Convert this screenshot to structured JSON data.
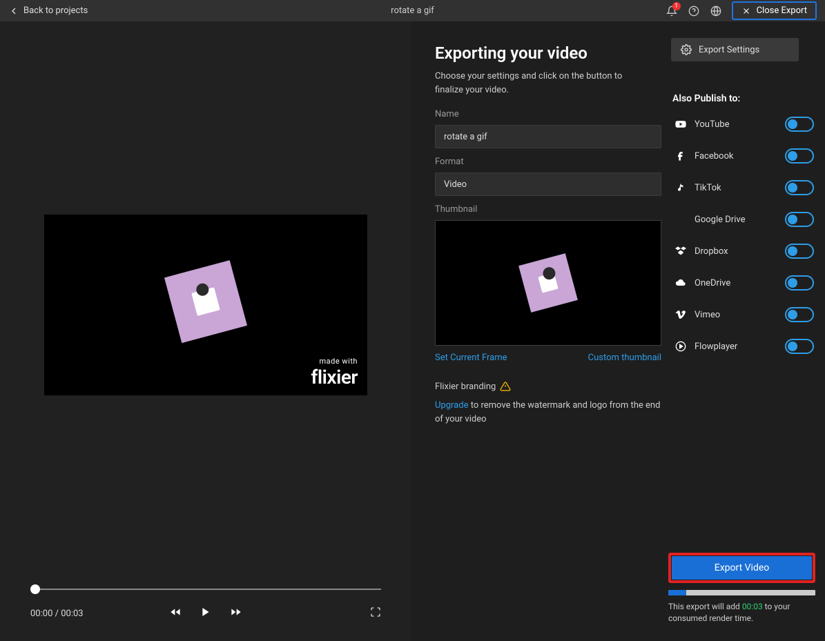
{
  "topbar": {
    "back_label": "Back to projects",
    "project_title": "rotate a gif",
    "notification_count": "1",
    "close_export_label": "Close Export"
  },
  "preview": {
    "watermark_small": "made with",
    "watermark_brand": "flixier",
    "time_current": "00:00",
    "time_total": "00:03"
  },
  "export": {
    "heading": "Exporting your video",
    "description": "Choose your settings and click on the button to finalize your video.",
    "name_label": "Name",
    "name_value": "rotate a gif",
    "format_label": "Format",
    "format_value": "Video",
    "thumbnail_label": "Thumbnail",
    "set_frame": "Set Current Frame",
    "custom_thumb": "Custom thumbnail",
    "branding_label": "Flixier branding",
    "upgrade_link": "Upgrade",
    "upgrade_rest": " to remove the watermark and logo from the end of your video"
  },
  "sidebar": {
    "export_settings": "Export Settings",
    "also_publish": "Also Publish to:",
    "items": [
      {
        "label": "YouTube"
      },
      {
        "label": "Facebook"
      },
      {
        "label": "TikTok"
      },
      {
        "label": "Google Drive"
      },
      {
        "label": "Dropbox"
      },
      {
        "label": "OneDrive"
      },
      {
        "label": "Vimeo"
      },
      {
        "label": "Flowplayer"
      }
    ],
    "export_button": "Export Video",
    "note_prefix": "This export will add ",
    "note_time": "00:03",
    "note_suffix": " to your consumed render time."
  }
}
